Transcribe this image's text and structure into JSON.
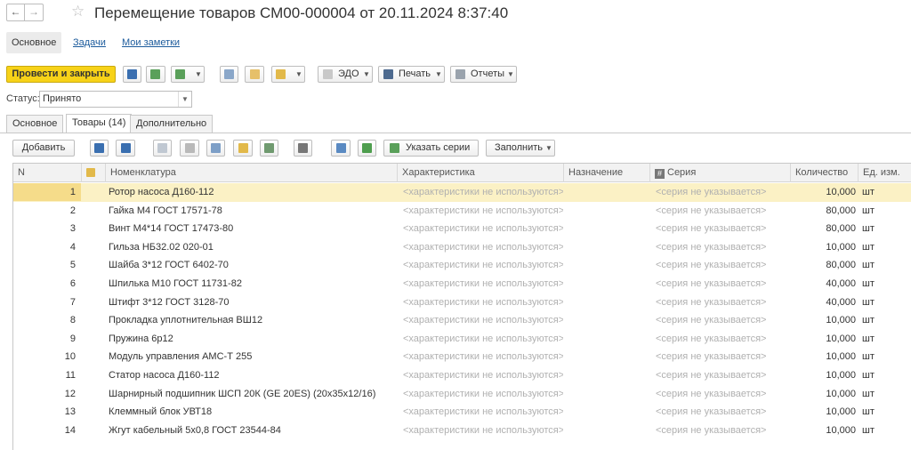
{
  "window": {
    "title": "Перемещение товаров СМ00-000004 от 20.11.2024 8:37:40"
  },
  "sections": {
    "main": "Основное",
    "tasks": "Задачи",
    "notes": "Мои заметки"
  },
  "toolbar": {
    "post_close": "Провести и закрыть",
    "edo": "ЭДО",
    "print": "Печать",
    "reports": "Отчеты"
  },
  "status": {
    "label": "Статус:",
    "value": "Принято"
  },
  "tabs": {
    "main": "Основное",
    "goods": "Товары (14)",
    "extra": "Дополнительно"
  },
  "table_toolbar": {
    "add": "Добавить",
    "series": "Указать серии",
    "fill": "Заполнить"
  },
  "columns": {
    "n": "N",
    "nom": "Номенклатура",
    "char": "Характеристика",
    "dest": "Назначение",
    "series": "Серия",
    "qty": "Количество",
    "unit": "Ед. изм."
  },
  "rows": [
    {
      "n": "1",
      "name": "Ротор насоса Д160-112",
      "char": "<характеристики не используются>",
      "series": "<серия не указывается>",
      "qty": "10,000",
      "unit": "шт"
    },
    {
      "n": "2",
      "name": "Гайка М4 ГОСТ 17571-78",
      "char": "<характеристики не используются>",
      "series": "<серия не указывается>",
      "qty": "80,000",
      "unit": "шт"
    },
    {
      "n": "3",
      "name": "Винт М4*14 ГОСТ 17473-80",
      "char": "<характеристики не используются>",
      "series": "<серия не указывается>",
      "qty": "80,000",
      "unit": "шт"
    },
    {
      "n": "4",
      "name": "Гильза НБ32.02 020-01",
      "char": "<характеристики не используются>",
      "series": "<серия не указывается>",
      "qty": "10,000",
      "unit": "шт"
    },
    {
      "n": "5",
      "name": "Шайба 3*12 ГОСТ 6402-70",
      "char": "<характеристики не используются>",
      "series": "<серия не указывается>",
      "qty": "80,000",
      "unit": "шт"
    },
    {
      "n": "6",
      "name": "Шпилька М10 ГОСТ 11731-82",
      "char": "<характеристики не используются>",
      "series": "<серия не указывается>",
      "qty": "40,000",
      "unit": "шт"
    },
    {
      "n": "7",
      "name": "Штифт 3*12 ГОСТ 3128-70",
      "char": "<характеристики не используются>",
      "series": "<серия не указывается>",
      "qty": "40,000",
      "unit": "шт"
    },
    {
      "n": "8",
      "name": "Прокладка уплотнительная ВШ12",
      "char": "<характеристики не используются>",
      "series": "<серия не указывается>",
      "qty": "10,000",
      "unit": "шт"
    },
    {
      "n": "9",
      "name": "Пружина 6р12",
      "char": "<характеристики не используются>",
      "series": "<серия не указывается>",
      "qty": "10,000",
      "unit": "шт"
    },
    {
      "n": "10",
      "name": "Модуль управления АМС-Т 255",
      "char": "<характеристики не используются>",
      "series": "<серия не указывается>",
      "qty": "10,000",
      "unit": "шт"
    },
    {
      "n": "11",
      "name": "Статор насоса Д160-112",
      "char": "<характеристики не используются>",
      "series": "<серия не указывается>",
      "qty": "10,000",
      "unit": "шт"
    },
    {
      "n": "12",
      "name": "Шарнирный подшипник ШСП 20К (GE 20ES) (20х35х12/16)",
      "char": "<характеристики не используются>",
      "series": "<серия не указывается>",
      "qty": "10,000",
      "unit": "шт"
    },
    {
      "n": "13",
      "name": "Клеммный блок УВТ18",
      "char": "<характеристики не используются>",
      "series": "<серия не указывается>",
      "qty": "10,000",
      "unit": "шт"
    },
    {
      "n": "14",
      "name": "Жгут кабельный 5х0,8 ГОСТ 23544-84",
      "char": "<характеристики не используются>",
      "series": "<серия не указывается>",
      "qty": "10,000",
      "unit": "шт"
    }
  ],
  "selected_row": 0,
  "colors": {
    "accent": "#f7d218",
    "link": "#1c5b9c",
    "selected_row": "#fbf1c5"
  }
}
